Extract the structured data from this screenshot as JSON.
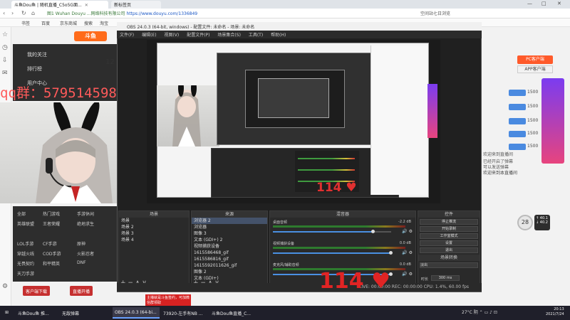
{
  "browser": {
    "tabs": [
      {
        "label": "斗鱼Dou鱼 | 随机直播_C5o5G面..."
      },
      {
        "label": "新标签页"
      }
    ],
    "nav_icons": [
      "back-icon",
      "forward-icon",
      "refresh-icon",
      "home-icon"
    ],
    "url_site": "图1 Wuhan Douyu ...网络科技有限公司",
    "url_link": "https://www.douyu.com/1336849",
    "addr_right": "空间站七日浏览",
    "bookmarks": [
      "书签",
      "百度",
      "京东商城",
      "搜索",
      "淘宝"
    ],
    "window_buttons": [
      "—",
      "□",
      "✕"
    ]
  },
  "douyu": {
    "logo": "斗鱼",
    "menu": [
      "我的关注",
      "排行榜",
      "用户中心"
    ],
    "number": "12",
    "qq_overlay": "qq群：579514598",
    "nav_items": [
      "全部",
      "热门游戏",
      "手游休闲",
      "英雄联盟",
      "王者荣耀",
      "绝地求生",
      "LOL手游",
      "CF手游",
      "原神",
      "穿越火线",
      "COD手游",
      "火影忍者",
      "无畏契约",
      "和平精英",
      "DNF",
      "天刀手游"
    ],
    "bottom_buttons": [
      "客户端下载",
      "直播开播"
    ],
    "right_msgs": [
      "欢迎来到直播间",
      "已经开启了弹幕",
      "可以发送弹幕"
    ],
    "pc_client": "PC客户端",
    "app_client": "APP客户端",
    "ranks": [
      "1500",
      "1500",
      "1500",
      "1500",
      "1500"
    ],
    "chat": "欢迎来到本直播间",
    "gauge_value": "28",
    "net_speed": [
      "↑ 40.1",
      "↓ 40.2"
    ],
    "notice": "主播就是斗鱼签约，可加微信群领取"
  },
  "obs": {
    "title": "OBS 24.0.3 (64-bit, windows) - 配置文件: 未命名 - 场景: 未命名",
    "menu": [
      "文件(F)",
      "编辑(E)",
      "视图(V)",
      "配置文件(P)",
      "场景集合(S)",
      "工具(T)",
      "帮助(H)"
    ],
    "docks": {
      "scenes_title": "场景",
      "sources_title": "来源",
      "mixer_title": "混音器",
      "controls_title": "控件"
    },
    "scenes": [
      "场景",
      "场景 2",
      "场景 3",
      "场景 4"
    ],
    "sources": [
      "浏览器 2",
      "浏览器",
      "图像 3",
      "文本 (GDI+) 2",
      "视频捕获设备",
      "1615586468_gif",
      "1615586816_gif",
      "1615592011626_gif",
      "图像 2",
      "文本 (GDI+)"
    ],
    "mixer": [
      {
        "label": "桌面音频",
        "value": "-2.2 dB",
        "fill": 0.85
      },
      {
        "label": "视频捕获设备",
        "value": "0.0 dB",
        "fill": 1.0
      },
      {
        "label": "麦克风/辅助音频",
        "value": "0.0 dB",
        "fill": 1.0
      }
    ],
    "controls": [
      "停止推流",
      "开始录制",
      "工作室模式",
      "设置",
      "退出"
    ],
    "transition_title": "场景转换",
    "transition_value": "淡出",
    "duration_label": "时长",
    "duration_value": "300 ms",
    "status": "LIVE: 00:00:00   REC: 00:00:00   CPU: 1.4%, 60.00 fps",
    "hearts": "114 ♥",
    "footer_icons": "+ − ∧ ∨"
  },
  "taskbar": {
    "items": [
      "斗鱼Dou鱼 推...",
      "无敌弹幕",
      "OBS 24.0.3 (64-bi...",
      "73920-左手有NB ...",
      "斗鱼Dou鱼直播_C..."
    ],
    "tray": "27°C 阴",
    "time": "20:13",
    "date": "2021/7/24"
  },
  "colors": {
    "accent": "#ff6b1a",
    "heart": "#e02424",
    "obs_bg": "#202020"
  }
}
